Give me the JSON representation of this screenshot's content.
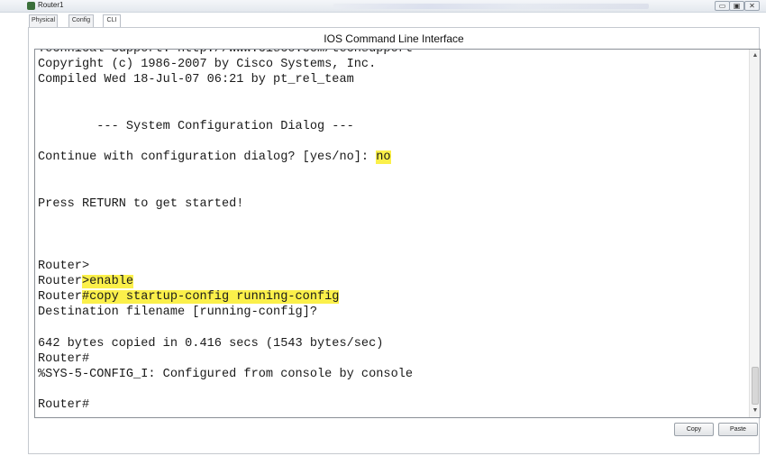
{
  "window": {
    "title": "Router1",
    "minimize_glyph": "▭",
    "maximize_glyph": "▣",
    "close_glyph": "✕"
  },
  "tabs": [
    {
      "label": "Physical"
    },
    {
      "label": "Config"
    },
    {
      "label": "CLI",
      "active": true
    }
  ],
  "panel_title": "IOS Command Line Interface",
  "terminal": {
    "lines": [
      {
        "text": "Technical Support: http://www.cisco.com/techsupport"
      },
      {
        "text": "Copyright (c) 1986-2007 by Cisco Systems, Inc."
      },
      {
        "text": "Compiled Wed 18-Jul-07 06:21 by pt_rel_team"
      },
      {
        "text": ""
      },
      {
        "text": ""
      },
      {
        "text": "        --- System Configuration Dialog ---"
      },
      {
        "text": ""
      },
      {
        "text": "Continue with configuration dialog? [yes/no]: ",
        "highlight": "no"
      },
      {
        "text": ""
      },
      {
        "text": ""
      },
      {
        "text": "Press RETURN to get started!"
      },
      {
        "text": ""
      },
      {
        "text": ""
      },
      {
        "text": ""
      },
      {
        "text": "Router>"
      },
      {
        "text": "Router",
        "highlight": ">enable"
      },
      {
        "text": "Router",
        "highlight": "#copy startup-config running-config"
      },
      {
        "text": "Destination filename [running-config]?"
      },
      {
        "text": ""
      },
      {
        "text": "642 bytes copied in 0.416 secs (1543 bytes/sec)"
      },
      {
        "text": "Router#"
      },
      {
        "text": "%SYS-5-CONFIG_I: Configured from console by console"
      },
      {
        "text": ""
      },
      {
        "text": "Router#"
      }
    ],
    "highlight_color": "#fbf04a",
    "scroll_up_glyph": "▲",
    "scroll_down_glyph": "▼"
  },
  "buttons": {
    "copy_label": "Copy",
    "paste_label": "Paste"
  }
}
